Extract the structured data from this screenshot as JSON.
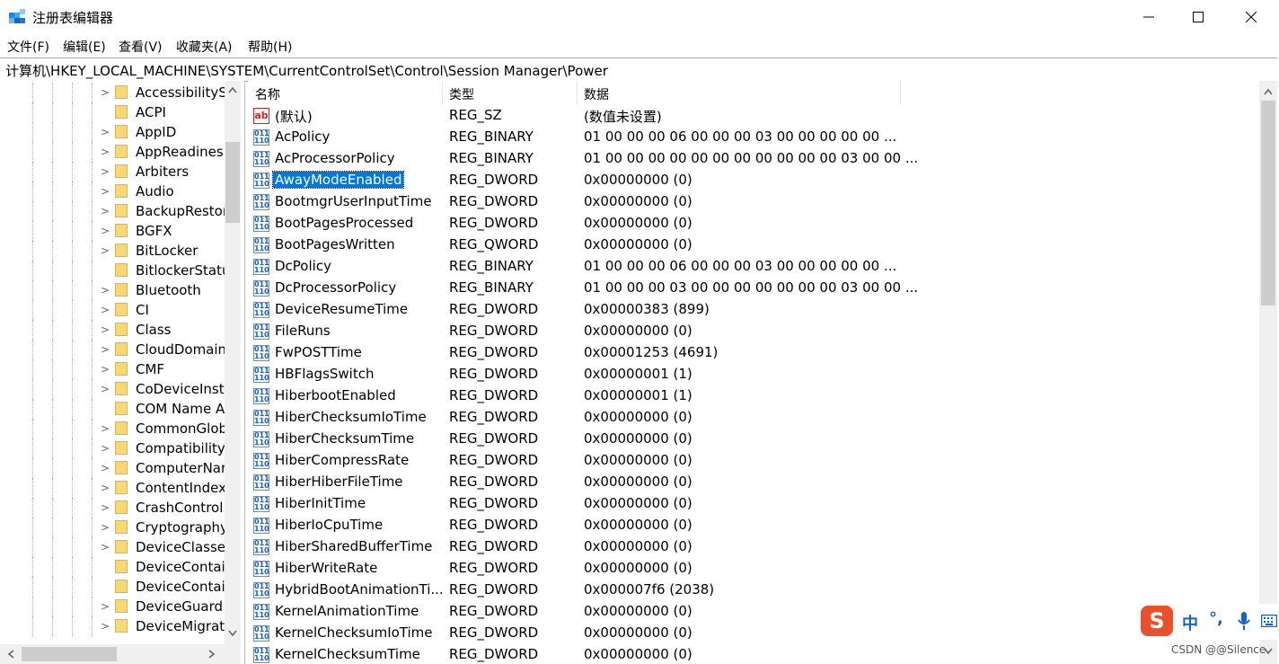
{
  "window": {
    "title": "注册表编辑器",
    "icons": [
      "regedit-icon",
      "minimize-icon",
      "maximize-icon",
      "close-icon"
    ]
  },
  "menu": [
    "文件(F)",
    "编辑(E)",
    "查看(V)",
    "收藏夹(A)",
    "帮助(H)"
  ],
  "address": "计算机\\HKEY_LOCAL_MACHINE\\SYSTEM\\CurrentControlSet\\Control\\Session Manager\\Power",
  "tree": {
    "items": [
      {
        "label": "AccessibilityS",
        "expandable": true
      },
      {
        "label": "ACPI",
        "expandable": false
      },
      {
        "label": "AppID",
        "expandable": true
      },
      {
        "label": "AppReadines",
        "expandable": true
      },
      {
        "label": "Arbiters",
        "expandable": true
      },
      {
        "label": "Audio",
        "expandable": true
      },
      {
        "label": "BackupRestor",
        "expandable": true
      },
      {
        "label": "BGFX",
        "expandable": true
      },
      {
        "label": "BitLocker",
        "expandable": true
      },
      {
        "label": "BitlockerStatu",
        "expandable": false
      },
      {
        "label": "Bluetooth",
        "expandable": true
      },
      {
        "label": "CI",
        "expandable": true
      },
      {
        "label": "Class",
        "expandable": true
      },
      {
        "label": "CloudDomain",
        "expandable": true
      },
      {
        "label": "CMF",
        "expandable": true
      },
      {
        "label": "CoDeviceInsta",
        "expandable": true
      },
      {
        "label": "COM Name A",
        "expandable": false
      },
      {
        "label": "CommonGlob",
        "expandable": true
      },
      {
        "label": "Compatibility",
        "expandable": true
      },
      {
        "label": "ComputerNar",
        "expandable": true
      },
      {
        "label": "ContentIndex",
        "expandable": true
      },
      {
        "label": "CrashControl",
        "expandable": true
      },
      {
        "label": "Cryptography",
        "expandable": true
      },
      {
        "label": "DeviceClasses",
        "expandable": true
      },
      {
        "label": "DeviceContai",
        "expandable": false
      },
      {
        "label": "DeviceContai",
        "expandable": false
      },
      {
        "label": "DeviceGuard",
        "expandable": true
      },
      {
        "label": "DeviceMigrat",
        "expandable": true
      }
    ]
  },
  "columns": {
    "name": "名称",
    "type": "类型",
    "data": "数据"
  },
  "values": [
    {
      "name": "(默认)",
      "type": "REG_SZ",
      "data": "(数值未设置)",
      "kind": "string"
    },
    {
      "name": "AcPolicy",
      "type": "REG_BINARY",
      "data": "01 00 00 00 06 00 00 00 03 00 00 00 00 00 ...",
      "kind": "binary"
    },
    {
      "name": "AcProcessorPolicy",
      "type": "REG_BINARY",
      "data": "01 00 00 00 00 00 00 00 00 00 00 00 03 00 00 ...",
      "kind": "binary"
    },
    {
      "name": "AwayModeEnabled",
      "type": "REG_DWORD",
      "data": "0x00000000 (0)",
      "kind": "binary",
      "selected": true
    },
    {
      "name": "BootmgrUserInputTime",
      "type": "REG_DWORD",
      "data": "0x00000000 (0)",
      "kind": "binary"
    },
    {
      "name": "BootPagesProcessed",
      "type": "REG_DWORD",
      "data": "0x00000000 (0)",
      "kind": "binary"
    },
    {
      "name": "BootPagesWritten",
      "type": "REG_QWORD",
      "data": "0x00000000 (0)",
      "kind": "binary"
    },
    {
      "name": "DcPolicy",
      "type": "REG_BINARY",
      "data": "01 00 00 00 06 00 00 00 03 00 00 00 00 00 ...",
      "kind": "binary"
    },
    {
      "name": "DcProcessorPolicy",
      "type": "REG_BINARY",
      "data": "01 00 00 00 03 00 00 00 00 00 00 00 03 00 00 ...",
      "kind": "binary"
    },
    {
      "name": "DeviceResumeTime",
      "type": "REG_DWORD",
      "data": "0x00000383 (899)",
      "kind": "binary"
    },
    {
      "name": "FileRuns",
      "type": "REG_DWORD",
      "data": "0x00000000 (0)",
      "kind": "binary"
    },
    {
      "name": "FwPOSTTime",
      "type": "REG_DWORD",
      "data": "0x00001253 (4691)",
      "kind": "binary"
    },
    {
      "name": "HBFlagsSwitch",
      "type": "REG_DWORD",
      "data": "0x00000001 (1)",
      "kind": "binary"
    },
    {
      "name": "HiberbootEnabled",
      "type": "REG_DWORD",
      "data": "0x00000001 (1)",
      "kind": "binary"
    },
    {
      "name": "HiberChecksumIoTime",
      "type": "REG_DWORD",
      "data": "0x00000000 (0)",
      "kind": "binary"
    },
    {
      "name": "HiberChecksumTime",
      "type": "REG_DWORD",
      "data": "0x00000000 (0)",
      "kind": "binary"
    },
    {
      "name": "HiberCompressRate",
      "type": "REG_DWORD",
      "data": "0x00000000 (0)",
      "kind": "binary"
    },
    {
      "name": "HiberHiberFileTime",
      "type": "REG_DWORD",
      "data": "0x00000000 (0)",
      "kind": "binary"
    },
    {
      "name": "HiberInitTime",
      "type": "REG_DWORD",
      "data": "0x00000000 (0)",
      "kind": "binary"
    },
    {
      "name": "HiberIoCpuTime",
      "type": "REG_DWORD",
      "data": "0x00000000 (0)",
      "kind": "binary"
    },
    {
      "name": "HiberSharedBufferTime",
      "type": "REG_DWORD",
      "data": "0x00000000 (0)",
      "kind": "binary"
    },
    {
      "name": "HiberWriteRate",
      "type": "REG_DWORD",
      "data": "0x00000000 (0)",
      "kind": "binary"
    },
    {
      "name": "HybridBootAnimationTi...",
      "type": "REG_DWORD",
      "data": "0x000007f6 (2038)",
      "kind": "binary"
    },
    {
      "name": "KernelAnimationTime",
      "type": "REG_DWORD",
      "data": "0x00000000 (0)",
      "kind": "binary"
    },
    {
      "name": "KernelChecksumIoTime",
      "type": "REG_DWORD",
      "data": "0x00000000 (0)",
      "kind": "binary"
    },
    {
      "name": "KernelChecksumTime",
      "type": "REG_DWORD",
      "data": "0x00000000 (0)",
      "kind": "binary"
    }
  ],
  "ime": {
    "logo": "S",
    "items": [
      "中",
      "°,"
    ]
  },
  "watermark": "CSDN @@Silence",
  "colors": {
    "selection": "#0078d7",
    "folder": "#f8d775",
    "ime": "#e8512c"
  }
}
